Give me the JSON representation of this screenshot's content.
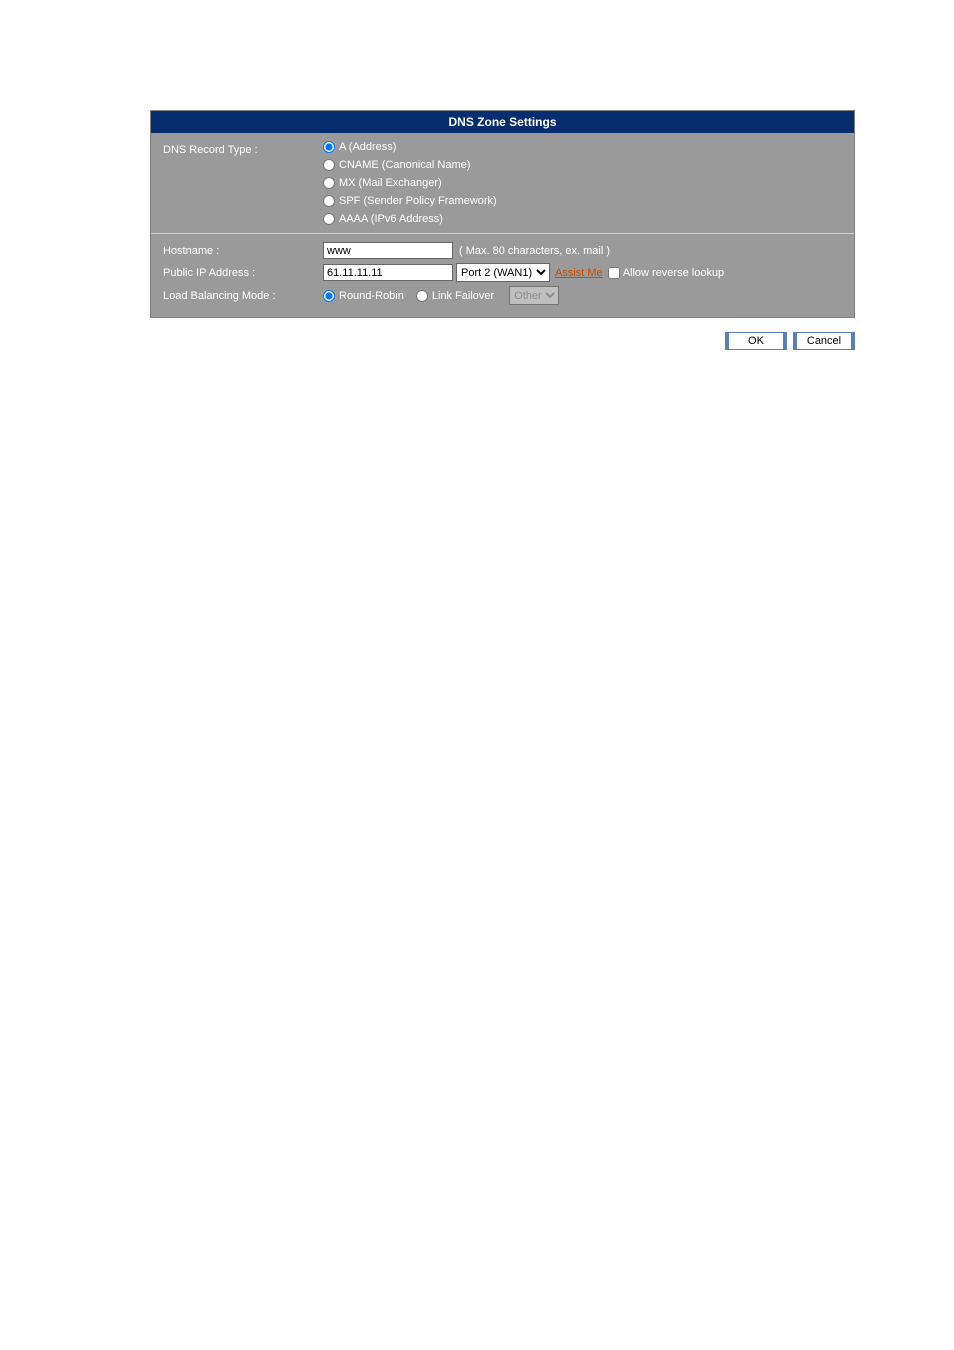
{
  "header": {
    "title": "DNS Zone Settings"
  },
  "record_type": {
    "label": "DNS Record Type :",
    "options": {
      "a": {
        "label": "A (Address)",
        "selected": true
      },
      "cname": {
        "label": "CNAME (Canonical Name)",
        "selected": false
      },
      "mx": {
        "label": "MX (Mail Exchanger)",
        "selected": false
      },
      "spf": {
        "label": "SPF (Sender Policy Framework)",
        "selected": false
      },
      "aaaa": {
        "label": "AAAA (IPv6 Address)",
        "selected": false
      }
    }
  },
  "hostname": {
    "label": "Hostname :",
    "value": "www",
    "hint": "( Max. 80 characters, ex. mail )"
  },
  "public_ip": {
    "label": "Public IP Address :",
    "value": "61.11.11.11",
    "port_selected": "Port 2 (WAN1)",
    "assist": "Assist Me",
    "reverse_label": "Allow reverse lookup",
    "reverse_checked": false
  },
  "lb_mode": {
    "label": "Load Balancing Mode :",
    "round_robin": {
      "label": "Round-Robin",
      "selected": true
    },
    "link_fail": {
      "label": "Link Failover",
      "selected": false
    },
    "other_selected": "Other"
  },
  "buttons": {
    "ok": "OK",
    "cancel": "Cancel"
  }
}
